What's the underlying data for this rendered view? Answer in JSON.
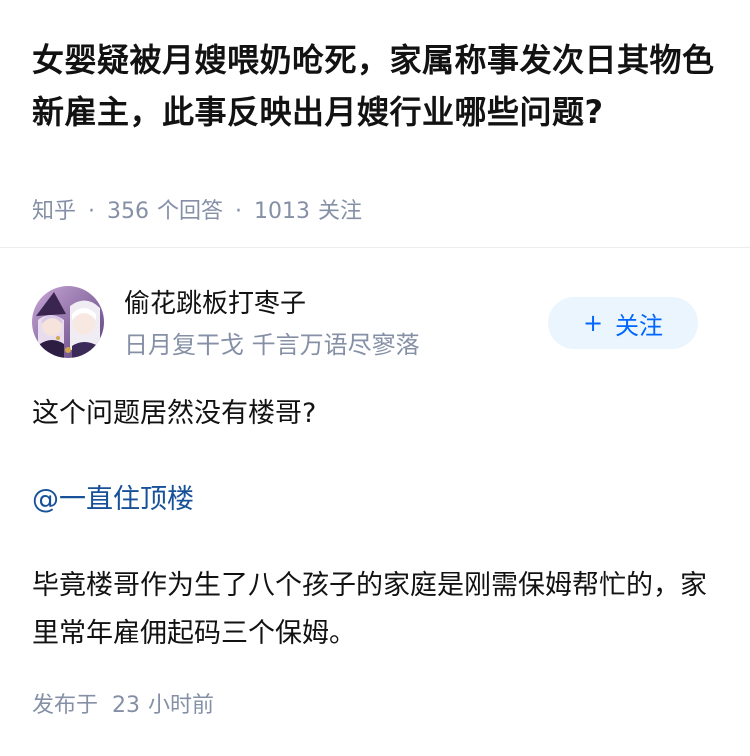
{
  "question": {
    "title": "女婴疑被月嫂喂奶呛死，家属称事发次日其物色新雇主，此事反映出月嫂行业哪些问题?",
    "meta": {
      "source": "知乎",
      "answer_count": "356",
      "answer_label": "个回答",
      "follow_count": "1013",
      "follow_label": "关注"
    }
  },
  "answer": {
    "author": {
      "name": "偷花跳板打枣子",
      "bio": "日月复干戈 千言万语尽寥落",
      "avatar_icon": "avatar-anime-girls"
    },
    "follow_button": {
      "plus": "+",
      "label": "关注",
      "color": "#0066ff",
      "background": "#ebf5fd"
    },
    "paragraphs": {
      "p1": "这个问题居然没有楼哥?",
      "mention": "@一直住顶楼",
      "p2": "毕竟楼哥作为生了八个孩子的家庭是刚需保姆帮忙的，家里常年雇佣起码三个保姆。"
    },
    "publish": {
      "prefix": "发布于",
      "value": "23",
      "unit": "小时前"
    }
  }
}
